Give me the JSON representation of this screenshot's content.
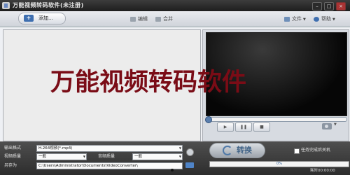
{
  "window": {
    "title": "万能视频转码软件(未注册)"
  },
  "toolbar": {
    "add_label": "添加...",
    "edit_label": "编辑",
    "merge_label": "合并",
    "file_label": "文件",
    "help_label": "帮助"
  },
  "watermark": "万能视频转码软件",
  "player": {
    "play": "▶",
    "pause": "❚❚",
    "stop": "■"
  },
  "output": {
    "format_label": "输出格式",
    "format_value": "H.264视频(*.mp4)",
    "video_quality_label": "视频质量",
    "video_quality_value": "一般",
    "audio_quality_label": "音频质量",
    "audio_quality_value": "一般",
    "save_as_label": "另存为",
    "save_path": "C:\\Users\\Administrator\\Documents\\VideoConverter\\"
  },
  "convert": {
    "button_label": "转换",
    "shutdown_label": "任务完成后关机",
    "progress_percent": 0,
    "progress_text": "0%",
    "elapsed_label": "耗时",
    "elapsed": "00:00:00"
  }
}
